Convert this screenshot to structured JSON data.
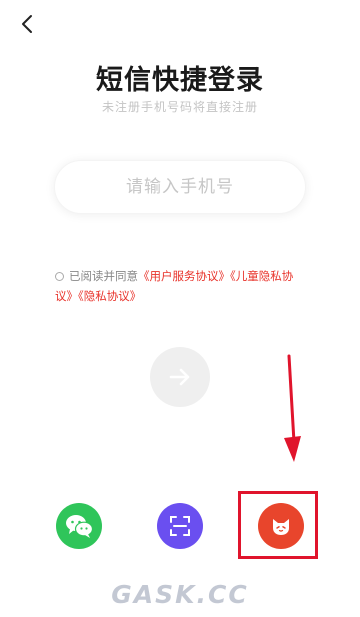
{
  "title": "短信快捷登录",
  "subtitle": "未注册手机号码将直接注册",
  "phone_input": {
    "placeholder": "请输入手机号",
    "value": ""
  },
  "agreement": {
    "prefix": "已阅读并同意",
    "links": [
      "《用户服务协议》",
      "《儿童隐私协议》",
      "《隐私协议》"
    ],
    "checked": false
  },
  "icons": {
    "back": "chevron-left-icon",
    "submit": "arrow-right-icon",
    "wechat": "wechat-icon",
    "scan": "scan-icon",
    "other": "cat-icon",
    "annotation": "red-arrow-down-icon"
  },
  "colors": {
    "wechat": "#2fc55a",
    "scan": "#6a4ff0",
    "other": "#e8452c",
    "link": "#e8322a",
    "annotation": "#e0142c"
  },
  "watermark": "GASK.CC"
}
